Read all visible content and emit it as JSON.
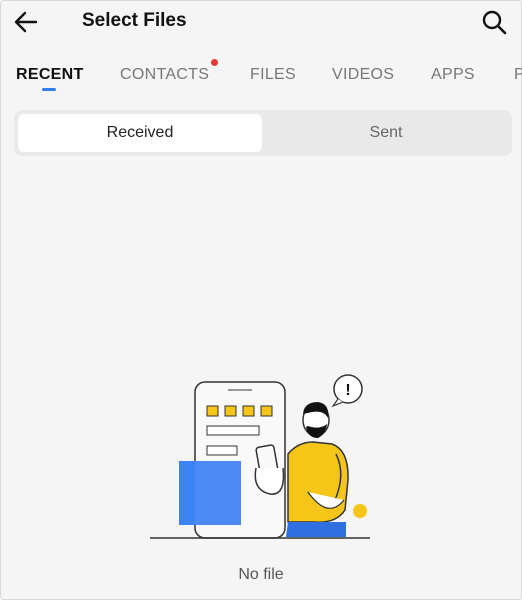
{
  "header": {
    "title": "Select Files",
    "back_icon": "back-arrow-icon",
    "search_icon": "search-icon"
  },
  "tabs": [
    {
      "label": "RECENT",
      "active": true
    },
    {
      "label": "CONTACTS",
      "badge": true
    },
    {
      "label": "FILES"
    },
    {
      "label": "VIDEOS"
    },
    {
      "label": "APPS"
    },
    {
      "label": "P"
    }
  ],
  "segment": {
    "received": "Received",
    "sent": "Sent"
  },
  "empty_state": {
    "message": "No file",
    "alert_symbol": "!"
  },
  "colors": {
    "accent": "#2f80ed",
    "badge": "#e53935",
    "illustration_yellow": "#f5c518",
    "illustration_blue": "#3b82f6"
  }
}
